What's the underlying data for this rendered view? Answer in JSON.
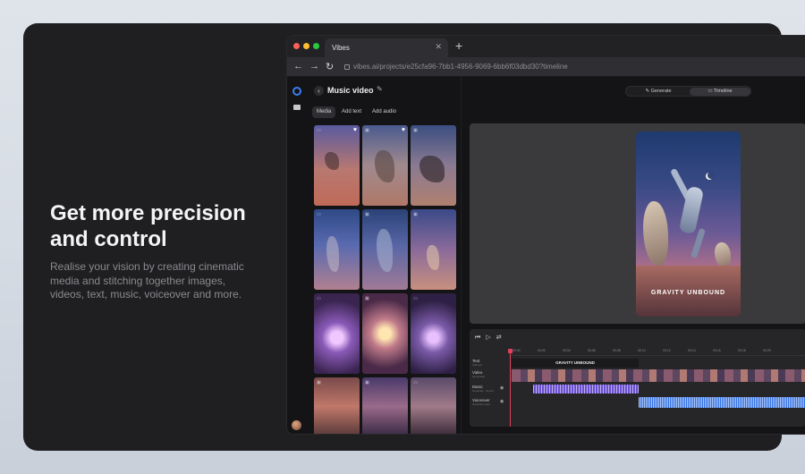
{
  "hero": {
    "title": "Get more precision and control",
    "description": "Realise your vision by creating cinematic media and stitching together images, videos, text, music, voiceover and more."
  },
  "browser": {
    "tab_title": "Vibes",
    "url": "vibes.ai/projects/e25cfa96-7bb1-4956-9069-6bb6f03dbd30?timeline",
    "icons": [
      "back-arrow-icon",
      "forward-arrow-icon",
      "reload-icon",
      "lock-icon",
      "close-icon",
      "plus-icon"
    ]
  },
  "media_panel": {
    "title": "Music video",
    "tabs": [
      "Media",
      "Add text",
      "Add audio"
    ],
    "active_tab": "Media"
  },
  "editor": {
    "modes": [
      "Generate",
      "Timeline"
    ],
    "active_mode": "Timeline",
    "preview_title": "GRAVITY UNBOUND"
  },
  "timeline": {
    "ticks": [
      "00:00",
      "00:02",
      "00:04",
      "00:06",
      "00:08",
      "00:10",
      "00:12",
      "00:14",
      "00:16",
      "00:18",
      "00:20"
    ],
    "tracks": {
      "text": {
        "label": "Text",
        "sub": "Add text"
      },
      "video": {
        "label": "Video",
        "sub": "Generated"
      },
      "music": {
        "label": "Music",
        "sub": "Generate · Sound"
      },
      "voice": {
        "label": "Voiceover",
        "sub": "Generate voice"
      }
    },
    "text_clip": "GRAVITY UNBOUND"
  },
  "colors": {
    "accent_blue": "#3d7cf5",
    "music_clip": "#6a4fd0",
    "voice_clip": "#2f6fe3",
    "playhead": "#e0405a"
  }
}
